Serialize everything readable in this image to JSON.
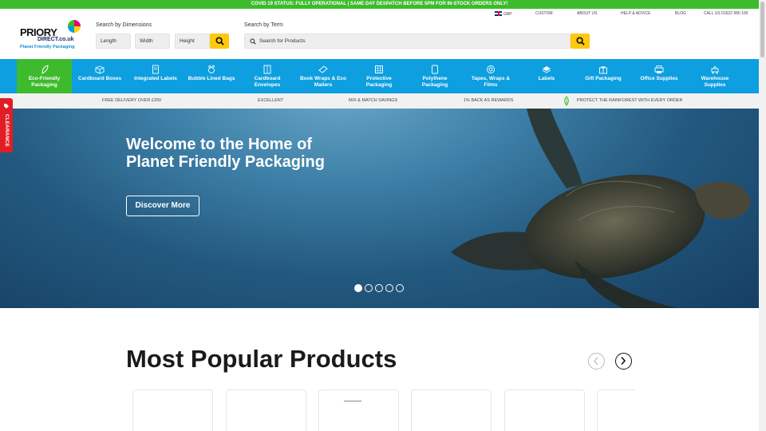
{
  "top_banner": "COVID 19 STATUS: FULLY OPERATIONAL | SAME DAY DESPATCH BEFORE 5PM FOR IN-STOCK ORDERS ONLY!",
  "utility": {
    "currency": "GBP",
    "links": [
      "CUSTOM",
      "ABOUT US",
      "HELP & ADVICE",
      "BLOG",
      "CALL US 01622 580 100"
    ]
  },
  "logo": {
    "line1": "PRIORY",
    "line2": "DIRECT.co.uk",
    "tagline": "Planet Friendly Packaging"
  },
  "search_dimensions": {
    "label": "Search by Dimensions",
    "fields": [
      "Length",
      "Width",
      "Height"
    ]
  },
  "search_term": {
    "label": "Search by Term",
    "placeholder": "Search for Products"
  },
  "nav": [
    {
      "label": "Eco-Friendly Packaging",
      "icon": "leaf-icon",
      "active": true
    },
    {
      "label": "Cardboard Boxes",
      "icon": "box-icon"
    },
    {
      "label": "Integrated Labels",
      "icon": "document-icon"
    },
    {
      "label": "Bubble Lined Bags",
      "icon": "bubble-icon"
    },
    {
      "label": "Cardboard Envelopes",
      "icon": "envelope-icon"
    },
    {
      "label": "Book Wraps & Eco Mailers",
      "icon": "book-icon"
    },
    {
      "label": "Protective Packaging",
      "icon": "grid-icon"
    },
    {
      "label": "Polythene Packaging",
      "icon": "bag-icon"
    },
    {
      "label": "Tapes, Wraps & Films",
      "icon": "tape-icon"
    },
    {
      "label": "Labels",
      "icon": "label-icon"
    },
    {
      "label": "Gift Packaging",
      "icon": "gift-icon"
    },
    {
      "label": "Office Supplies",
      "icon": "printer-icon"
    },
    {
      "label": "Warehouse Supplies",
      "icon": "trolley-icon"
    }
  ],
  "usp": [
    "FREE DELIVERY OVER £250",
    "EXCELLENT",
    "MIX & MATCH SAVINGS",
    "1% BACK AS REWARDS",
    "PROTECT THE RAINFOREST WITH EVERY ORDER"
  ],
  "hero": {
    "title_line1": "Welcome to the Home of",
    "title_line2": "Planet Friendly Packaging",
    "cta": "Discover More",
    "slides": 5,
    "active_slide": 1
  },
  "clearance": "CLEARANCE",
  "popular": {
    "title": "Most Popular Products"
  },
  "colors": {
    "green": "#3dbb2c",
    "blue": "#0d9fe0",
    "yellow": "#fdc80d",
    "red": "#e11d26"
  }
}
